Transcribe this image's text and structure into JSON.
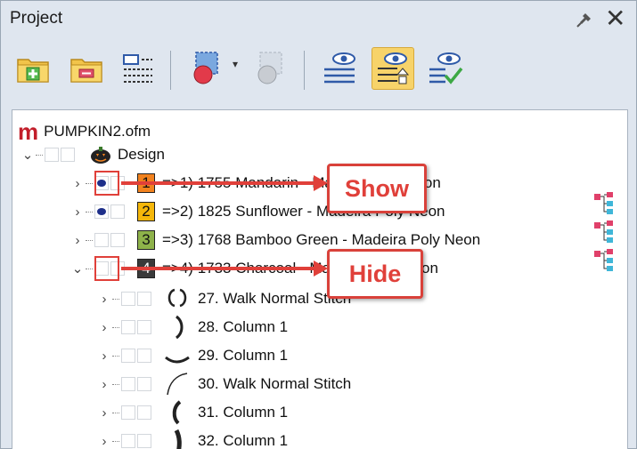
{
  "panel": {
    "title": "Project"
  },
  "toolbar": {
    "buttons": [
      {
        "name": "add-folder-icon"
      },
      {
        "name": "remove-folder-icon"
      },
      {
        "name": "stitch-list-icon"
      },
      {
        "name": "color-shape-icon"
      },
      {
        "name": "color-shape-disabled-icon"
      },
      {
        "name": "view-list-icon"
      },
      {
        "name": "view-properties-icon",
        "active": true
      },
      {
        "name": "view-check-icon"
      }
    ],
    "dropdown_glyph": "▾"
  },
  "tree": {
    "root": {
      "label": "PUMPKIN2.ofm"
    },
    "design": {
      "label": "Design"
    },
    "colors": [
      {
        "num": "1",
        "label": "=>1) 1755 Mandarin - Madeira Poly Neon",
        "color": "#f2821e",
        "eye": true
      },
      {
        "num": "2",
        "label": "=>2) 1825 Sunflower - Madeira Poly Neon",
        "color": "#f5b70a",
        "eye": true
      },
      {
        "num": "3",
        "label": "=>3) 1768 Bamboo Green - Madeira Poly Neon",
        "color": "#8eb24a",
        "eye": false
      },
      {
        "num": "4",
        "label": "=>4) 1733 Charcoal - Madeira Poly Neon",
        "color": "#3a3a3a",
        "eye": false
      }
    ],
    "objects": [
      {
        "label": "27. Walk Normal Stitch"
      },
      {
        "label": "28. Column 1"
      },
      {
        "label": "29. Column 1"
      },
      {
        "label": "30. Walk Normal Stitch"
      },
      {
        "label": "31. Column 1"
      },
      {
        "label": "32. Column 1"
      }
    ]
  },
  "annotations": {
    "show": "Show",
    "hide": "Hide"
  }
}
